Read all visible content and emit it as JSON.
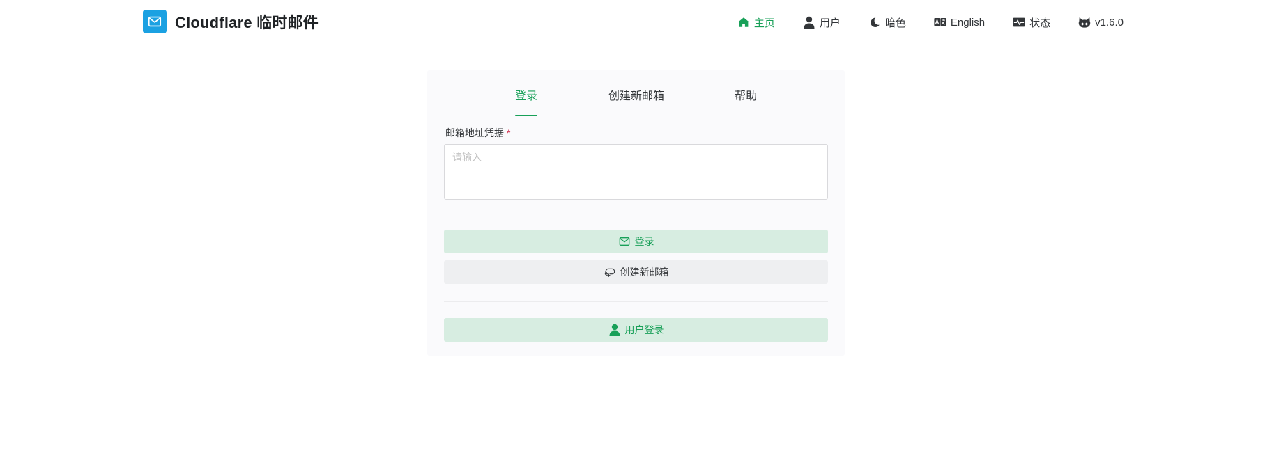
{
  "brand": {
    "title": "Cloudflare 临时邮件",
    "logo_icon": "mail-icon",
    "logo_color": "#1ba1e2"
  },
  "nav": {
    "items": [
      {
        "label": "主页",
        "icon": "home-icon",
        "active": true
      },
      {
        "label": "用户",
        "icon": "user-icon",
        "active": false
      },
      {
        "label": "暗色",
        "icon": "moon-icon",
        "active": false
      },
      {
        "label": "English",
        "icon": "translate-icon",
        "active": false
      },
      {
        "label": "状态",
        "icon": "status-icon",
        "active": false
      },
      {
        "label": "v1.6.0",
        "icon": "github-icon",
        "active": false
      }
    ]
  },
  "tabs": {
    "items": [
      {
        "label": "登录",
        "active": true
      },
      {
        "label": "创建新邮箱",
        "active": false
      },
      {
        "label": "帮助",
        "active": false
      }
    ]
  },
  "form": {
    "credential_label": "邮箱地址凭据",
    "required_mark": "*",
    "credential_value": "",
    "credential_placeholder": "请输入"
  },
  "buttons": {
    "login_label": "登录",
    "create_label": "创建新邮箱",
    "user_login_label": "用户登录"
  },
  "colors": {
    "accent": "#18a058",
    "accent_bg": "#d7ede1",
    "required": "#d03050",
    "card_bg": "#fafafc"
  }
}
